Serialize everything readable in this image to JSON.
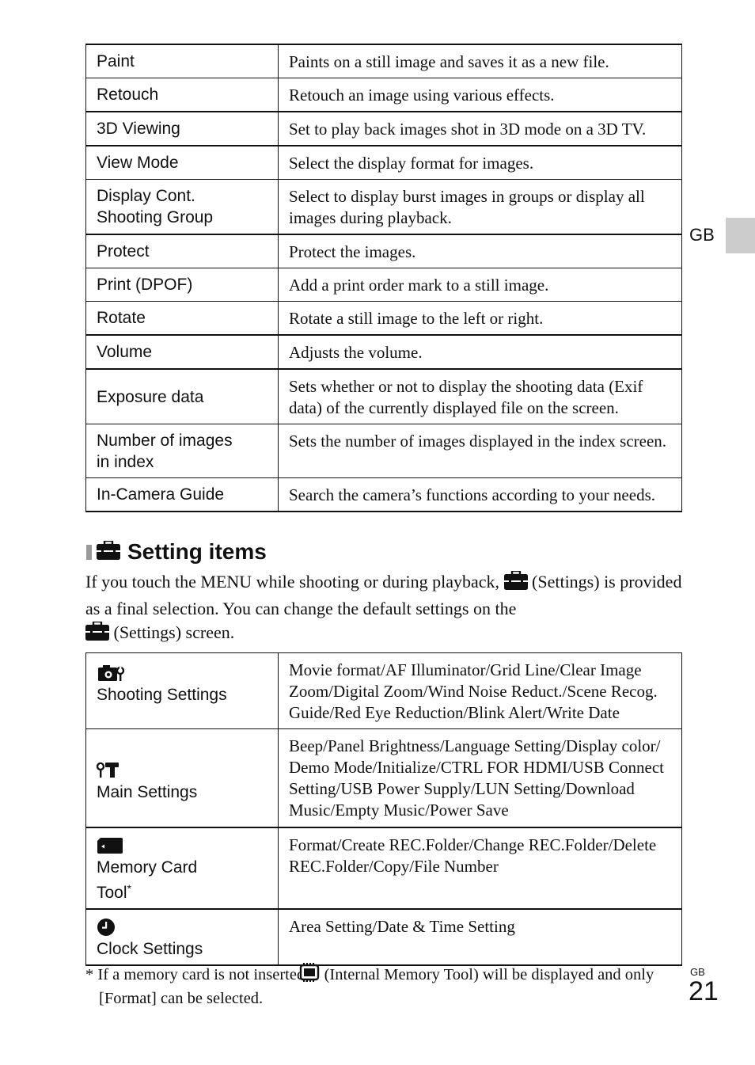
{
  "playback_table": {
    "rows": [
      {
        "item": "Paint",
        "description": "Paints on a still image and saves it as a new file."
      },
      {
        "item": "Retouch",
        "description": "Retouch an image using various effects."
      },
      {
        "item": "3D Viewing",
        "description": "Set to play back images shot in 3D mode on a 3D TV."
      },
      {
        "item": "View Mode",
        "description": "Select the display format for images."
      },
      {
        "item": "Display Cont.\nShooting Group",
        "item_line1": "Display Cont.",
        "item_line2": "Shooting Group",
        "description": "Select to display burst images in groups or display all images during playback."
      },
      {
        "item": "Protect",
        "description": "Protect the images."
      },
      {
        "item": "Print (DPOF)",
        "description": "Add a print order mark to a still image."
      },
      {
        "item": "Rotate",
        "description": "Rotate a still image to the left or right."
      },
      {
        "item": "Volume",
        "description": "Adjusts the volume."
      },
      {
        "item": "Exposure data",
        "description": "Sets whether or not to display the shooting data (Exif data) of the currently displayed file on the screen."
      },
      {
        "item": "Number of images in index",
        "item_line1": "Number of images",
        "item_line2": "in index",
        "description": "Sets the number of images displayed in the index screen."
      },
      {
        "item": "In-Camera Guide",
        "description": "Search the camera’s functions according to your needs."
      }
    ]
  },
  "section": {
    "icon": "settings-toolbox-icon",
    "title": "Setting items",
    "intro_part1": "If you touch the MENU while shooting or during playback,",
    "intro_part2": "(Settings) is provided as a final selection. You can change the default settings on the",
    "intro_part3": "(Settings) screen."
  },
  "settings_table": {
    "rows": [
      {
        "icon": "camera-wrench-icon",
        "category": "Shooting Settings",
        "items": "Movie format/AF Illuminator/Grid Line/Clear Image Zoom/Digital Zoom/Wind Noise Reduct./Scene Recog. Guide/Red Eye Reduction/Blink Alert/Write Date"
      },
      {
        "icon": "wrench-hammer-icon",
        "category": "Main Settings",
        "items": "Beep/Panel Brightness/Language Setting/Display color/ Demo Mode/Initialize/CTRL FOR HDMI/USB Connect Setting/USB Power Supply/LUN Setting/Download Music/Empty Music/Power Save"
      },
      {
        "icon": "memory-card-icon",
        "category_line1": "Memory Card",
        "category_line2": "Tool",
        "category_mark": "*",
        "items": "Format/Create REC.Folder/Change REC.Folder/Delete REC.Folder/Copy/File Number"
      },
      {
        "icon": "clock-icon",
        "category": "Clock Settings",
        "items": "Area Setting/Date & Time Setting"
      }
    ]
  },
  "footnote": {
    "mark": "*",
    "part1": "If a memory card is not inserted,",
    "icon": "internal-memory-icon",
    "part2": "(Internal Memory Tool) will be displayed and only [Format] can be selected."
  },
  "side_tab": {
    "label": "GB"
  },
  "page": {
    "region": "GB",
    "number": "21"
  },
  "colors": {
    "text": "#111111",
    "tab_gray": "#cccccc",
    "heading_bar": "#999999"
  }
}
